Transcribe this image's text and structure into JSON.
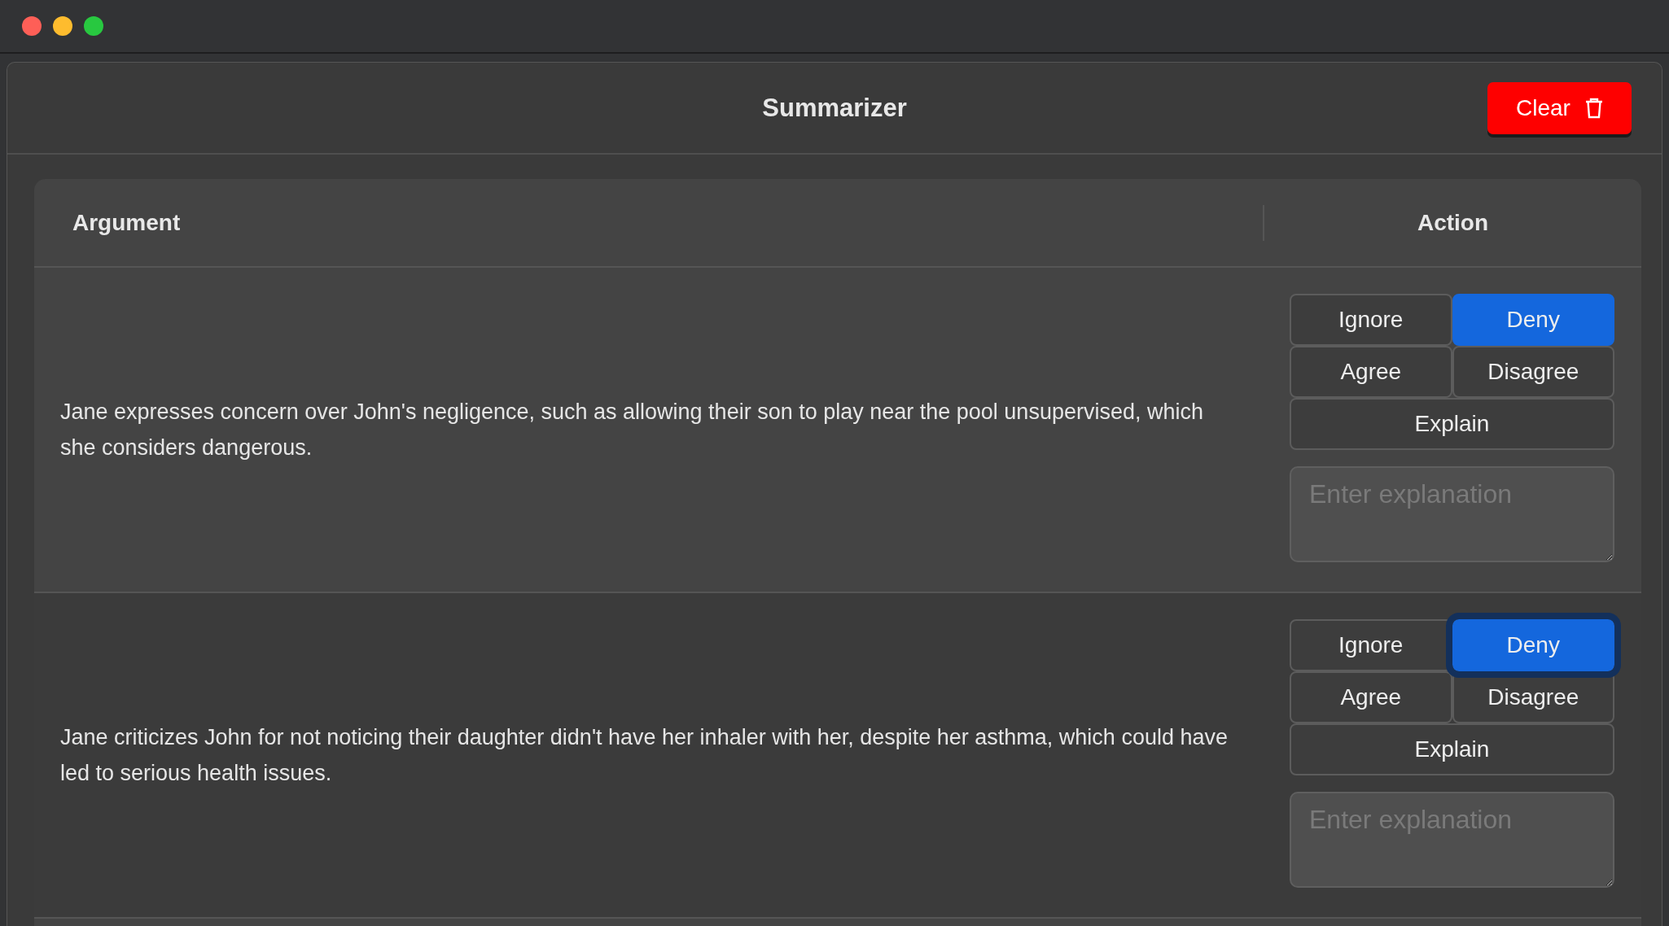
{
  "window": {
    "title": "Summarizer"
  },
  "clear_button": {
    "label": "Clear"
  },
  "table": {
    "columns": [
      "Argument",
      "Action"
    ],
    "rows": [
      {
        "argument": "Jane expresses concern over John's negligence, such as allowing their son to play near the pool unsupervised, which she considers dangerous.",
        "actions": [
          {
            "label": "Ignore",
            "selected": false,
            "focused": false
          },
          {
            "label": "Deny",
            "selected": true,
            "focused": false
          },
          {
            "label": "Agree",
            "selected": false,
            "focused": false
          },
          {
            "label": "Disagree",
            "selected": false,
            "focused": false
          },
          {
            "label": "Explain",
            "selected": false,
            "focused": false
          }
        ],
        "explanation": {
          "placeholder": "Enter explanation"
        }
      },
      {
        "argument": "Jane criticizes John for not noticing their daughter didn't have her inhaler with her, despite her asthma, which could have led to serious health issues.",
        "actions": [
          {
            "label": "Ignore",
            "selected": false,
            "focused": false
          },
          {
            "label": "Deny",
            "selected": true,
            "focused": true
          },
          {
            "label": "Agree",
            "selected": false,
            "focused": false
          },
          {
            "label": "Disagree",
            "selected": false,
            "focused": false
          },
          {
            "label": "Explain",
            "selected": false,
            "focused": false
          }
        ],
        "explanation": {
          "placeholder": "Enter explanation"
        }
      }
    ]
  }
}
